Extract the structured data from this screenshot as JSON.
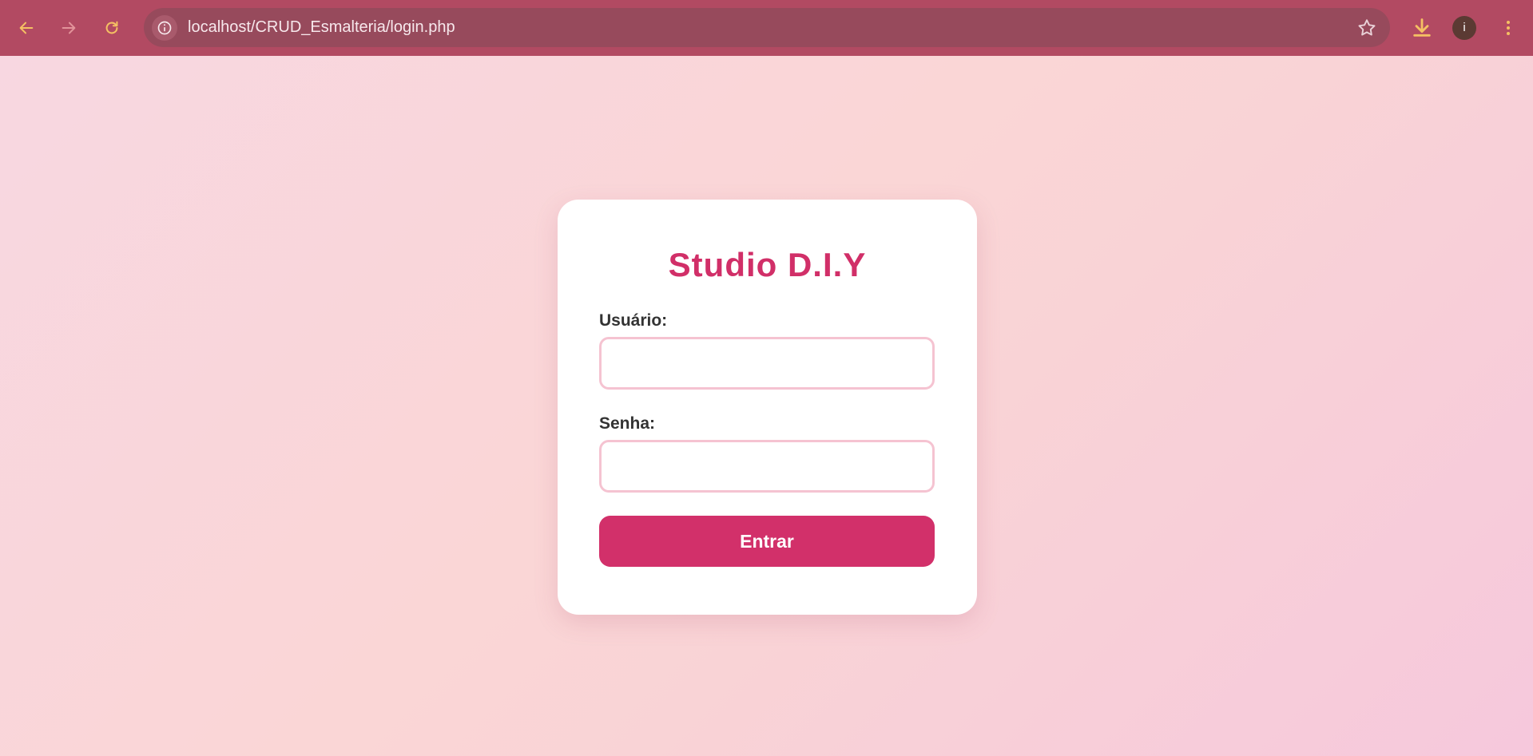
{
  "browser": {
    "url": "localhost/CRUD_Esmalteria/login.php",
    "profile_initial": "i",
    "icons": {
      "back": "arrow-left-icon",
      "forward": "arrow-right-icon",
      "reload": "reload-icon",
      "site_info": "info-icon",
      "bookmark": "star-icon",
      "download": "download-icon",
      "menu": "kebab-menu-icon"
    },
    "colors": {
      "toolbar": "#b24a62",
      "address_bar": "#974a5c",
      "icon_accent": "#f5c063"
    }
  },
  "login": {
    "title": "Studio D.I.Y",
    "username_label": "Usuário:",
    "username_value": "",
    "password_label": "Senha:",
    "password_value": "",
    "submit_label": "Entrar"
  },
  "colors": {
    "accent": "#d2306a",
    "input_border": "#f5c3d1",
    "label_text": "#333333"
  }
}
